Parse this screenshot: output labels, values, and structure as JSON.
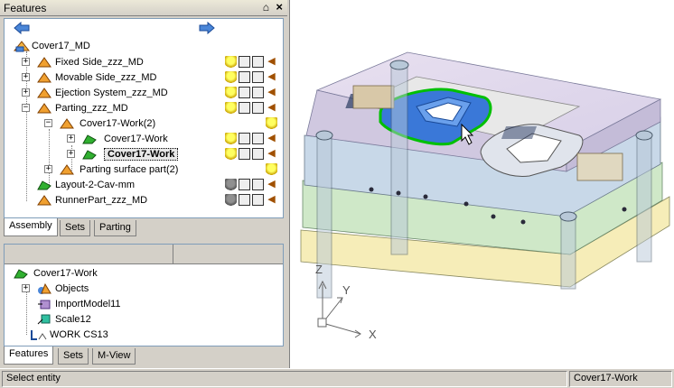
{
  "panel": {
    "title": "Features",
    "pin_glyph": "⌂",
    "close_glyph": "×"
  },
  "tree1": {
    "items": [
      {
        "label": "Cover17_MD"
      },
      {
        "label": "Fixed Side_zzz_MD"
      },
      {
        "label": "Movable Side_zzz_MD"
      },
      {
        "label": "Ejection System_zzz_MD"
      },
      {
        "label": "Parting_zzz_MD"
      },
      {
        "label": "Cover17-Work(2)"
      },
      {
        "label": "Cover17-Work"
      },
      {
        "label": "Cover17-Work"
      },
      {
        "label": "Parting surface part(2)"
      },
      {
        "label": "Layout-2-Cav-mm"
      },
      {
        "label": "RunnerPart_zzz_MD"
      }
    ],
    "expander_plus": "+",
    "expander_minus": "−"
  },
  "tabs1": [
    "Assembly",
    "Sets",
    "Parting"
  ],
  "tree2": {
    "items": [
      {
        "label": "Cover17-Work"
      },
      {
        "label": "Objects"
      },
      {
        "label": "ImportModel11"
      },
      {
        "label": "Scale12"
      },
      {
        "label": "WORK CS13"
      }
    ]
  },
  "tabs2": [
    "Features",
    "Sets",
    "M-View"
  ],
  "axes": {
    "z": "Z",
    "y": "Y",
    "x": "X"
  },
  "status": {
    "left": "Select entity",
    "right": "Cover17-Work"
  },
  "colors": {
    "selected_highlight": "#00c000",
    "part_blue": "#3a78d8"
  }
}
